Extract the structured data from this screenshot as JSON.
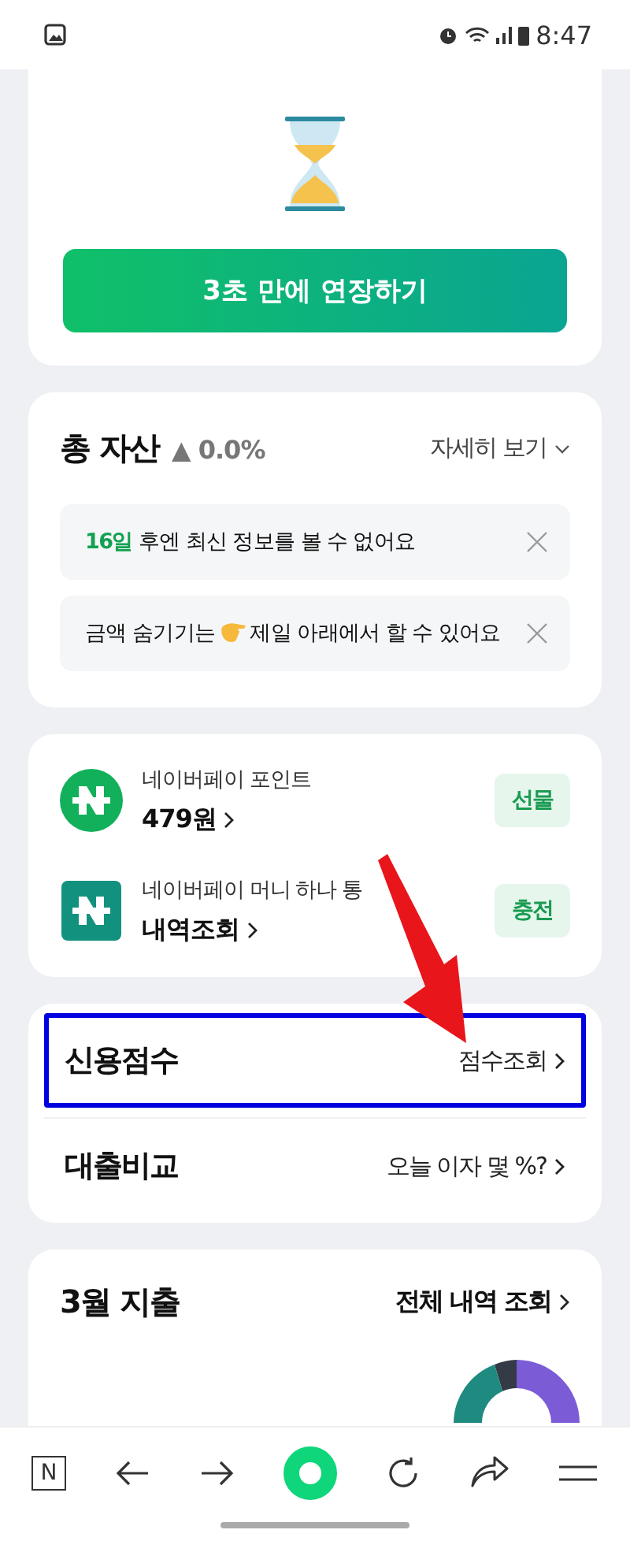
{
  "status_bar": {
    "time": "8:47"
  },
  "extend_card": {
    "button": "3초 만에 연장하기"
  },
  "assets": {
    "title": "총 자산",
    "change": "▲ 0.0%",
    "detail_link": "자세히 보기",
    "notices": [
      {
        "kind": "plain",
        "text": "**16일** 후엔 최신 정보를 볼 수 없어요"
      },
      {
        "kind": "hand",
        "before": "금액 숨기기는",
        "after": "제일 아래에서 할 수 있어요"
      }
    ]
  },
  "pay_items": [
    {
      "kind": "circle",
      "name": "네이버페이 포인트",
      "value": "479원",
      "action": "선물"
    },
    {
      "kind": "square",
      "name": "네이버페이 머니 하나 통",
      "value": "내역조회",
      "action": "충전"
    }
  ],
  "menu_rows": [
    {
      "title": "신용점수",
      "link": "점수조회",
      "highlighted": true
    },
    {
      "title": "대출비교",
      "link": "오늘 이자 몇 %?",
      "highlighted": false
    }
  ],
  "spending": {
    "title": "3월 지출",
    "link": "전체 내역 조회"
  },
  "nav": {
    "home_label": "N"
  }
}
